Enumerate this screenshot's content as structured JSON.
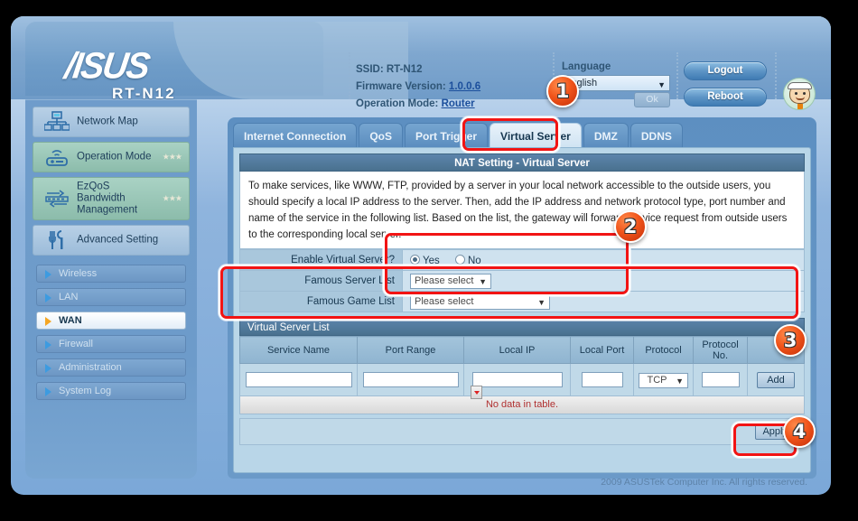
{
  "header": {
    "brand": "/ISUS",
    "model": "RT-N12",
    "ssid_label": "SSID:",
    "ssid_value": "RT-N12",
    "firmware_label": "Firmware Version:",
    "firmware_value": "1.0.0.6",
    "opmode_label": "Operation Mode:",
    "opmode_value": "Router",
    "language_label": "Language",
    "language_value": "English",
    "ok_label": "Ok",
    "logout_label": "Logout",
    "reboot_label": "Reboot",
    "mascot_name": "asus-mascot-icon"
  },
  "sidebar": {
    "primary": [
      {
        "label": "Network Map",
        "icon": "network-map-icon",
        "style": "blue",
        "stars": ""
      },
      {
        "label": "Operation Mode",
        "icon": "router-signal-icon",
        "style": "green",
        "stars": "★★★"
      },
      {
        "label": "EzQoS\nBandwidth\nManagement",
        "icon": "bandwidth-icon",
        "style": "green",
        "stars": "★★★"
      },
      {
        "label": "Advanced Setting",
        "icon": "tools-icon",
        "style": "blue",
        "stars": ""
      }
    ],
    "secondary": [
      {
        "label": "Wireless",
        "active": false
      },
      {
        "label": "LAN",
        "active": false
      },
      {
        "label": "WAN",
        "active": true
      },
      {
        "label": "Firewall",
        "active": false
      },
      {
        "label": "Administration",
        "active": false
      },
      {
        "label": "System Log",
        "active": false
      }
    ]
  },
  "tabs": [
    {
      "label": "Internet Connection",
      "selected": false
    },
    {
      "label": "QoS",
      "selected": false
    },
    {
      "label": "Port Trigger",
      "selected": false
    },
    {
      "label": "Virtual Server",
      "selected": true
    },
    {
      "label": "DMZ",
      "selected": false
    },
    {
      "label": "DDNS",
      "selected": false
    }
  ],
  "content": {
    "section_title": "NAT Setting - Virtual Server",
    "description": "To make services, like WWW, FTP, provided by a server in your local network accessible to the outside users, you should specify a local IP address to the server. Then, add the IP address and network protocol type, port number and name of the service in the following list. Based on the list, the gateway will forward service request from outside users to the corresponding local server.",
    "form": {
      "enable_label": "Enable Virtual Server?",
      "enable_yes": "Yes",
      "enable_no": "No",
      "enable_value": "Yes",
      "famous_server_label": "Famous Server List",
      "famous_server_value": "Please select",
      "famous_game_label": "Famous Game List",
      "famous_game_value": "Please select"
    },
    "list_title": "Virtual Server List",
    "columns": [
      "Service Name",
      "Port Range",
      "Local IP",
      "Local Port",
      "Protocol",
      "Protocol No.",
      ""
    ],
    "row_values": {
      "service_name": "",
      "port_range": "",
      "local_ip": "",
      "local_port": "",
      "protocol": "TCP",
      "protocol_no": "",
      "add_label": "Add"
    },
    "no_data_text": "No data in table.",
    "apply_label": "Apply"
  },
  "footer": {
    "copyright": "2009 ASUSTek Computer Inc. All rights reserved."
  },
  "annotations": {
    "badges": [
      {
        "number": "1",
        "target": "virtual-server-tab"
      },
      {
        "number": "2",
        "target": "virtual-server-enable-form"
      },
      {
        "number": "3",
        "target": "virtual-server-entry-row"
      },
      {
        "number": "4",
        "target": "apply-button"
      }
    ]
  },
  "colors": {
    "accent": "#f21414",
    "brand_blue": "#4a718f",
    "active_item": "#f5a623"
  }
}
